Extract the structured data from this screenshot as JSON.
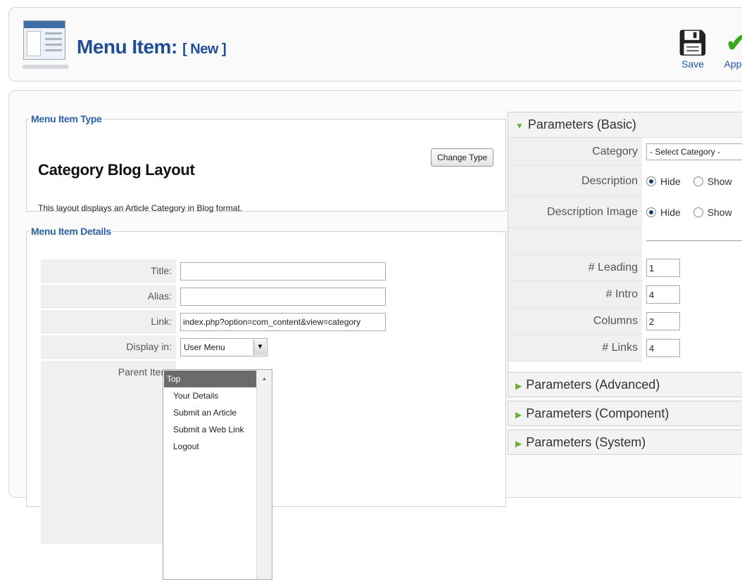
{
  "header": {
    "title": "Menu Item:",
    "subtitle": "[ New ]",
    "save_label": "Save",
    "apply_label": "Apply",
    "page_icon": "menu-page-icon",
    "save_icon": "floppy-disk-icon",
    "apply_icon": "checkmark-icon"
  },
  "menu_item_type": {
    "legend": "Menu Item Type",
    "name": "Category Blog Layout",
    "description": "This layout displays an Article Category in Blog format.",
    "change_type_label": "Change Type"
  },
  "details": {
    "legend": "Menu Item Details",
    "title_label": "Title:",
    "title_value": "",
    "alias_label": "Alias:",
    "alias_value": "",
    "link_label": "Link:",
    "link_value": "index.php?option=com_content&view=category",
    "display_in_label": "Display in:",
    "display_in_value": "User Menu",
    "parent_item_label": "Parent Item:",
    "parent_items": [
      "Top",
      "Your Details",
      "Submit an Article",
      "Submit a Web Link",
      "Logout"
    ],
    "parent_selected": "Top"
  },
  "params_basic": {
    "heading": "Parameters (Basic)",
    "category_label": "Category",
    "category_value": "- Select Category -",
    "description_label": "Description",
    "description_image_label": "Description Image",
    "hide_label": "Hide",
    "show_label": "Show",
    "leading_label": "# Leading",
    "leading_value": "1",
    "intro_label": "# Intro",
    "intro_value": "4",
    "columns_label": "Columns",
    "columns_value": "2",
    "links_label": "# Links",
    "links_value": "4"
  },
  "collapsed_panels": {
    "advanced": "Parameters (Advanced)",
    "component": "Parameters (Component)",
    "system": "Parameters (System)"
  },
  "colors": {
    "title_blue": "#1f4e96",
    "legend_blue": "#2c5fa5",
    "apply_green": "#3aa81c",
    "selected_gray": "#6b6b6b"
  }
}
